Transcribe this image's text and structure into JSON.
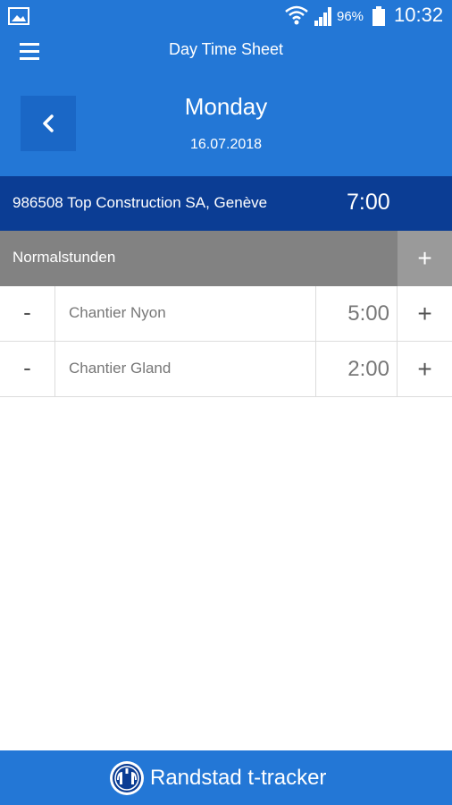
{
  "status_bar": {
    "battery_percent": "96%",
    "time": "10:32"
  },
  "header": {
    "title": "Day Time Sheet",
    "day_name": "Monday",
    "date": "16.07.2018"
  },
  "project": {
    "name": "986508 Top Construction SA, Genève",
    "total": "7:00"
  },
  "category": {
    "label": "Normalstunden",
    "add_symbol": "+"
  },
  "entries": [
    {
      "minus_symbol": "-",
      "name": "Chantier Nyon",
      "time": "5:00",
      "plus_symbol": "+"
    },
    {
      "minus_symbol": "-",
      "name": "Chantier Gland",
      "time": "2:00",
      "plus_symbol": "+"
    }
  ],
  "footer": {
    "brand": "Randstad t-tracker"
  },
  "colors": {
    "primary": "#2377d6",
    "project_bar": "#0b3d94",
    "category_bar": "#828282"
  }
}
